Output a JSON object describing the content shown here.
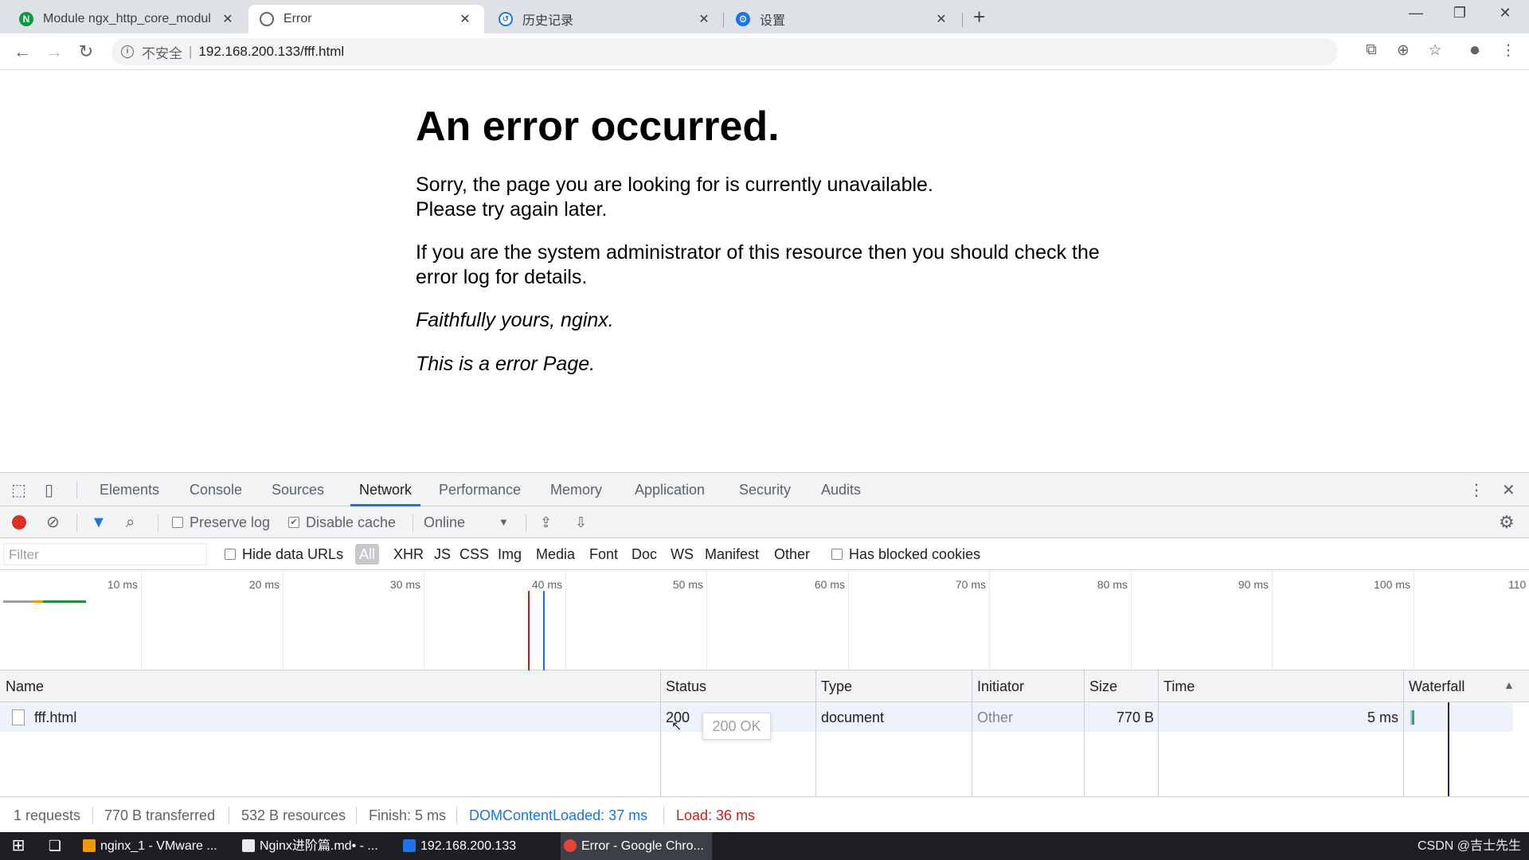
{
  "browser": {
    "tabs": [
      {
        "title": "Module ngx_http_core_modul",
        "icon": "nginx-icon",
        "color": "#0b9a3a",
        "active": false
      },
      {
        "title": "Error",
        "icon": "globe-icon",
        "color": "#5f6368",
        "active": true
      },
      {
        "title": "历史记录",
        "icon": "history-icon",
        "color": "#1a73e8",
        "active": false
      },
      {
        "title": "设置",
        "icon": "gear-icon",
        "color": "#1a73e8",
        "active": false
      }
    ],
    "new_tab": "+",
    "security_label": "不安全",
    "url": "192.168.200.133/fff.html"
  },
  "page": {
    "heading": "An error occurred.",
    "p1_line1": "Sorry, the page you are looking for is currently unavailable.",
    "p1_line2": "Please try again later.",
    "p2_line1": "If you are the system administrator of this resource then you should check the",
    "p2_line2": "error log for details.",
    "signature": "Faithfully yours, nginx.",
    "note": "This is a error Page."
  },
  "devtools": {
    "tabs": [
      "Elements",
      "Console",
      "Sources",
      "Network",
      "Performance",
      "Memory",
      "Application",
      "Security",
      "Audits"
    ],
    "active_tab": "Network",
    "toolbar": {
      "preserve_log": "Preserve log",
      "disable_cache": "Disable cache",
      "throttle": "Online"
    },
    "filter": {
      "placeholder": "Filter",
      "hide_data_urls": "Hide data URLs",
      "types": [
        "All",
        "XHR",
        "JS",
        "CSS",
        "Img",
        "Media",
        "Font",
        "Doc",
        "WS",
        "Manifest",
        "Other"
      ],
      "has_blocked_cookies": "Has blocked cookies"
    },
    "overview_ticks": [
      "10 ms",
      "20 ms",
      "30 ms",
      "40 ms",
      "50 ms",
      "60 ms",
      "70 ms",
      "80 ms",
      "90 ms",
      "100 ms",
      "110"
    ],
    "columns": [
      "Name",
      "Status",
      "Type",
      "Initiator",
      "Size",
      "Time",
      "Waterfall"
    ],
    "rows": [
      {
        "name": "fff.html",
        "status": "200",
        "type": "document",
        "initiator": "Other",
        "size": "770 B",
        "time": "5 ms"
      }
    ],
    "tooltip": "200 OK",
    "status": {
      "requests": "1 requests",
      "transferred": "770 B transferred",
      "resources": "532 B resources",
      "finish": "Finish: 5 ms",
      "dom_loaded": "DOMContentLoaded: 37 ms",
      "load": "Load: 36 ms"
    }
  },
  "taskbar": {
    "items": [
      "nginx_1 - VMware ...",
      "Nginx进阶篇.md• - ...",
      "192.168.200.133",
      "Error - Google Chro..."
    ],
    "watermark": "CSDN @吉士先生"
  },
  "colors": {
    "accent": "#1a73e8",
    "record": "#d93025",
    "dom_loaded": "#1a73e8",
    "load": "#c5221f"
  }
}
